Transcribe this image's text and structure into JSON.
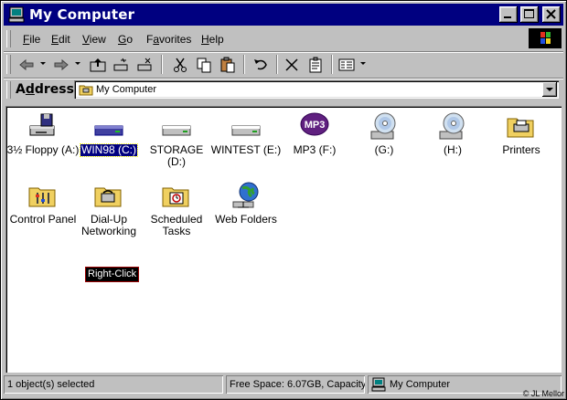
{
  "window": {
    "title": "My Computer"
  },
  "title_buttons": [
    "minimize",
    "maximize",
    "close"
  ],
  "menu": [
    {
      "key": "F",
      "rest": "ile"
    },
    {
      "key": "E",
      "rest": "dit"
    },
    {
      "key": "V",
      "rest": "iew"
    },
    {
      "key": "G",
      "rest": "o"
    },
    {
      "key": "",
      "pre": "F",
      "key2": "a",
      "rest": "vorites"
    },
    {
      "key": "H",
      "rest": "elp"
    }
  ],
  "menu_labels": {
    "favorites_pre": "F",
    "favorites_key": "a",
    "favorites_rest": "vorites"
  },
  "address": {
    "label_pre": "A",
    "label_key": "d",
    "label_rest": "dress",
    "value": "My Computer"
  },
  "items": [
    {
      "label": "3½ Floppy (A:)",
      "icon": "floppy-drive-icon"
    },
    {
      "label": "WIN98 (C:)",
      "icon": "hard-drive-icon",
      "selected": true
    },
    {
      "label": "STORAGE (D:)",
      "icon": "hard-drive-icon"
    },
    {
      "label": "WINTEST (E:)",
      "icon": "hard-drive-icon"
    },
    {
      "label": "MP3 (F:)",
      "icon": "mp3-disc-icon"
    },
    {
      "label": "(G:)",
      "icon": "cd-drive-icon"
    },
    {
      "label": "(H:)",
      "icon": "cd-drive-icon"
    },
    {
      "label": "Printers",
      "icon": "printers-folder-icon"
    },
    {
      "label": "Control Panel",
      "icon": "control-panel-folder-icon"
    },
    {
      "label": "Dial-Up Networking",
      "icon": "dialup-folder-icon"
    },
    {
      "label": "Scheduled Tasks",
      "icon": "scheduled-tasks-folder-icon"
    },
    {
      "label": "Web Folders",
      "icon": "web-folders-icon"
    }
  ],
  "annotation": "Right-Click",
  "mp3_badge": "MP3",
  "status": {
    "selection": "1 object(s) selected",
    "free_space": "Free Space: 6.07GB, Capacity",
    "location": "My Computer"
  },
  "copyright": "© JL Mellor",
  "colors": {
    "titlebar": "#000080",
    "face": "#c0c0c0",
    "selection": "#000080"
  }
}
